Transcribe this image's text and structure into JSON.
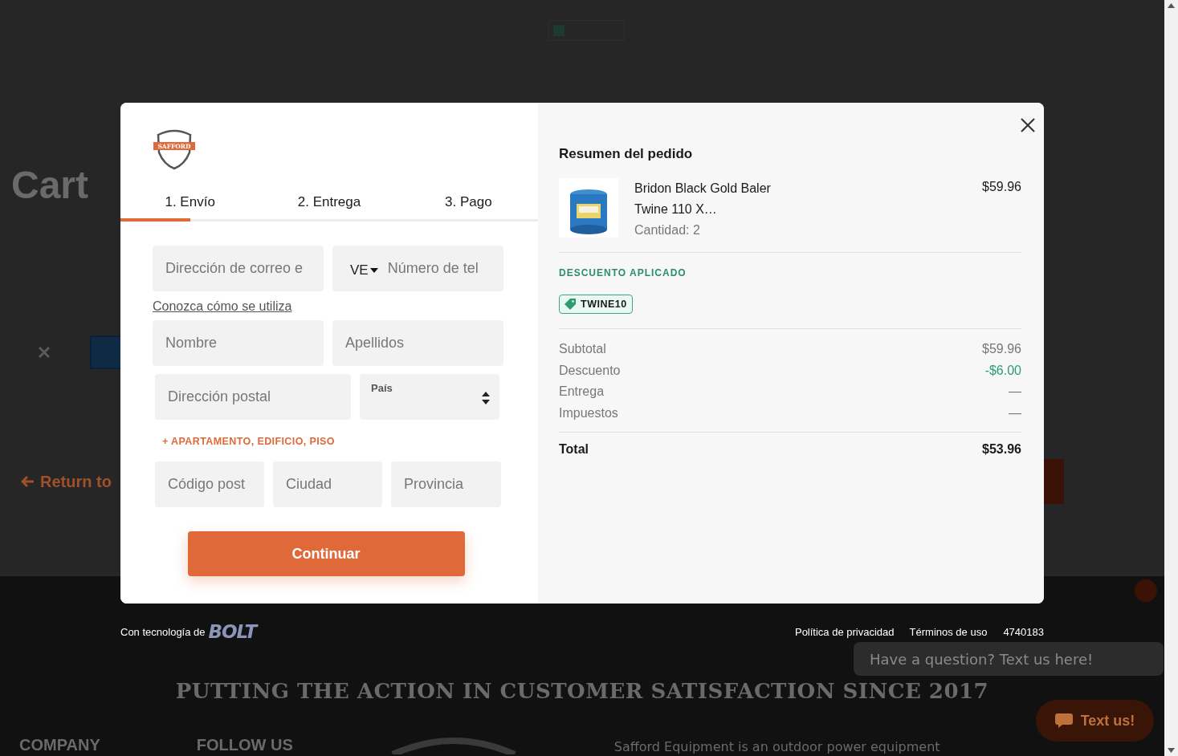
{
  "background": {
    "page_title": "Cart",
    "return_link": "Return to",
    "slogan": "PUTTING THE ACTION IN CUSTOMER SATISFACTION SINCE 2017",
    "footer_headings": [
      "COMPANY",
      "FOLLOW US"
    ],
    "about": "Safford Equipment is an outdoor power equipment",
    "chat_prompt": "Have a question? Text us here!",
    "chat_button": "Text us!"
  },
  "checkout": {
    "logo_text": "SAFFORD",
    "tabs": [
      {
        "label": "1. Envío",
        "selected": true
      },
      {
        "label": "2. Entrega",
        "selected": false
      },
      {
        "label": "3. Pago",
        "selected": false
      }
    ],
    "email": {
      "placeholder": "Dirección de correo e"
    },
    "phone": {
      "country": "VE",
      "placeholder": "Número de tel"
    },
    "help_link": "Conozca cómo se utiliza",
    "first_name": {
      "placeholder": "Nombre"
    },
    "last_name": {
      "placeholder": "Apellidos"
    },
    "address": {
      "placeholder": "Dirección postal"
    },
    "country": {
      "label": "País"
    },
    "add_address_line": "+ APARTAMENTO, EDIFICIO, PISO",
    "postal_code": {
      "placeholder": "Código post"
    },
    "city": {
      "placeholder": "Ciudad"
    },
    "province": {
      "placeholder": "Provincia"
    },
    "continue_button": "Continuar"
  },
  "summary": {
    "title": "Resumen del pedido",
    "items": [
      {
        "name": "Bridon Black Gold Baler Twine 110 X…",
        "quantity": "Cantidad: 2",
        "price": "$59.96"
      }
    ],
    "discount_heading": "DESCUENTO APLICADO",
    "discount_code": "TWINE10",
    "rows": [
      {
        "label": "Subtotal",
        "value": "$59.96",
        "kind": "amount"
      },
      {
        "label": "Descuento",
        "value": "-$6.00",
        "kind": "discount"
      },
      {
        "label": "Entrega",
        "value": "—",
        "kind": "pending"
      },
      {
        "label": "Impuestos",
        "value": "—",
        "kind": "pending"
      }
    ],
    "total": {
      "label": "Total",
      "value": "$53.96"
    }
  },
  "powered_by": {
    "label": "Con tecnología de",
    "brand": "BOLT"
  },
  "footer_links": [
    "Política de privacidad",
    "Términos de uso"
  ],
  "reference": "4740183"
}
